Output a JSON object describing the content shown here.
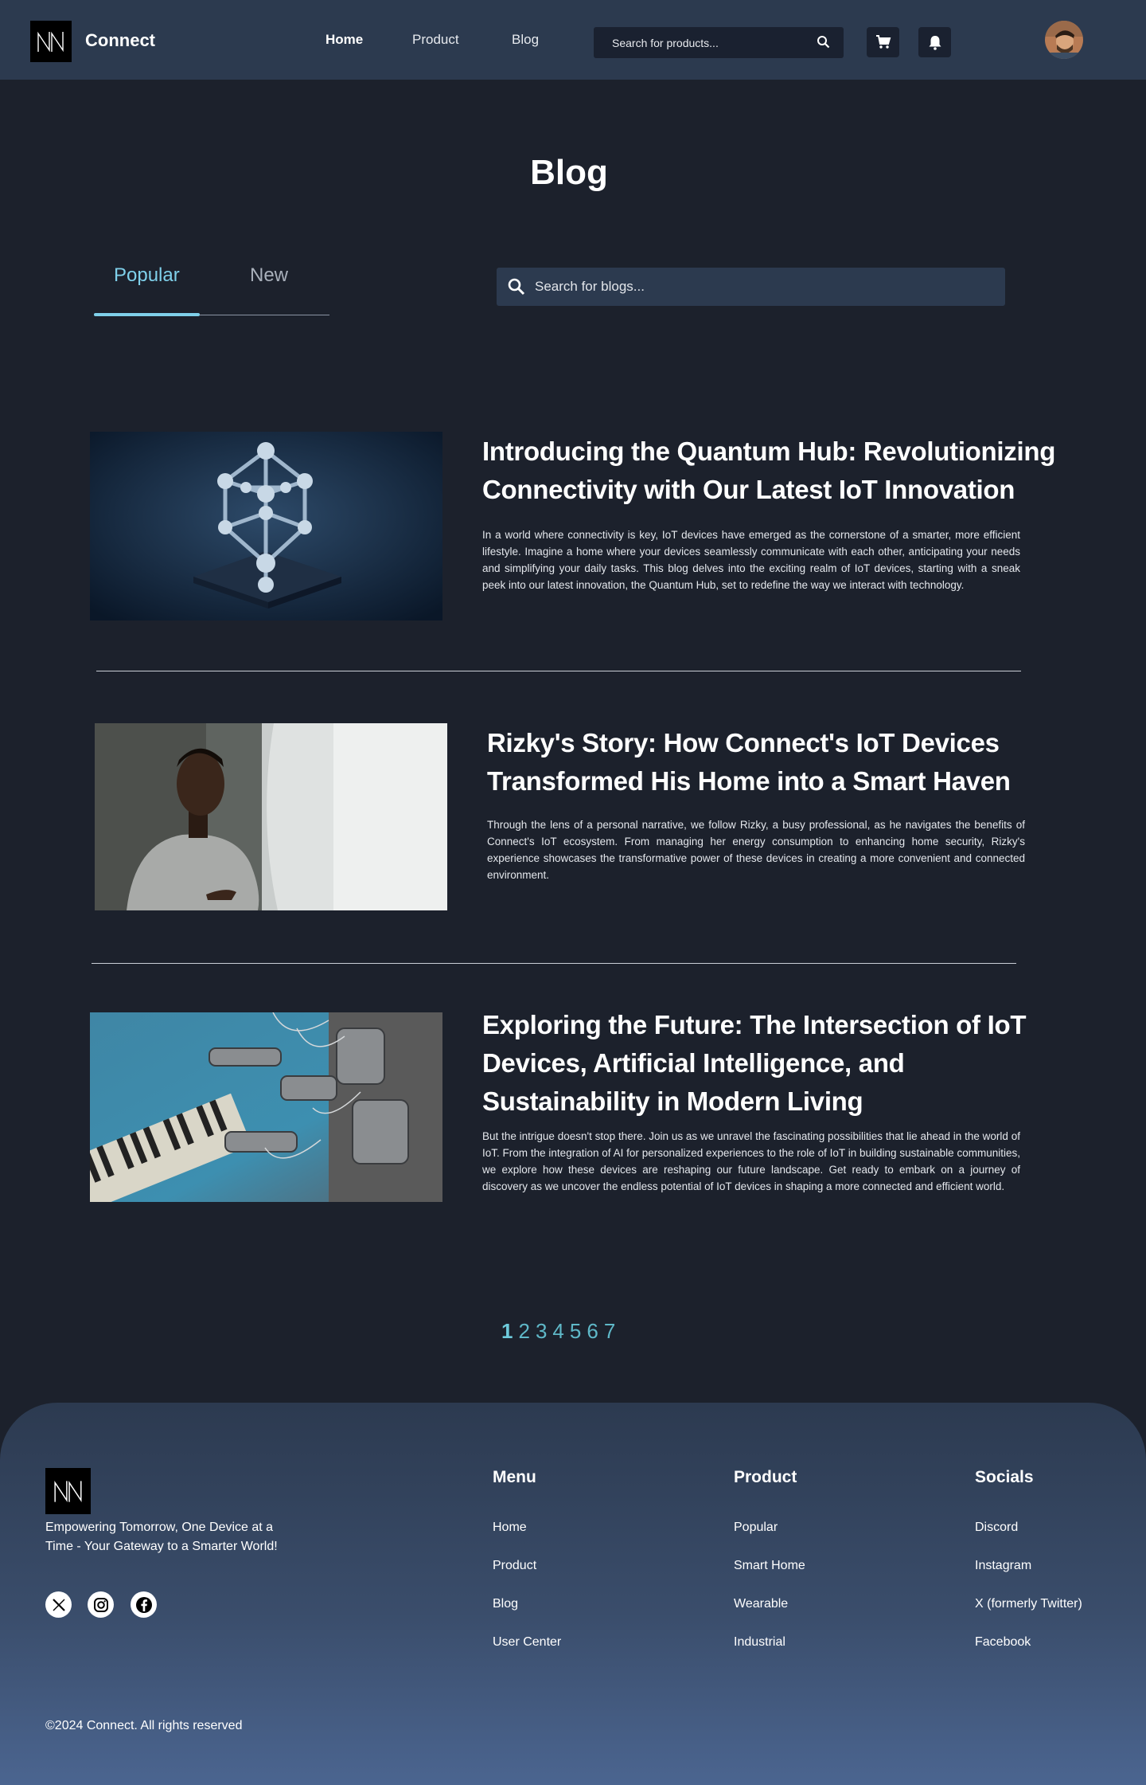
{
  "header": {
    "brand": "Connect",
    "nav": [
      "Home",
      "Product",
      "Blog"
    ],
    "search_placeholder": "Search for products...",
    "icons": [
      "search-icon",
      "cart-icon",
      "bell-icon"
    ]
  },
  "blog": {
    "title": "Blog",
    "tabs": [
      "Popular",
      "New"
    ],
    "active_tab": "Popular",
    "search_placeholder": "Search for blogs..."
  },
  "posts": [
    {
      "title": "Introducing the Quantum Hub: Revolutionizing Connectivity with Our Latest IoT Innovation",
      "excerpt": "In a world where connectivity is key, IoT devices have emerged as the  cornerstone of a smarter, more efficient lifestyle. Imagine a home where  your devices seamlessly communicate with each other, anticipating your  needs and simplifying your daily tasks. This blog delves into the  exciting realm of IoT devices, starting with a sneak peek into our latest innovation, the Quantum Hub, set to redefine the way we interact with technology."
    },
    {
      "title": "Rizky's Story: How Connect's IoT Devices Transformed His Home into a Smart Haven",
      "excerpt": "Through the lens of a personal narrative, we follow Rizky, a busy professional, as he navigates the benefits of Connect's IoT ecosystem. From managing her energy  consumption to enhancing home security, Rizky's experience showcases the  transformative power of these devices in creating a more convenient and connected environment."
    },
    {
      "title": "Exploring the Future: The Intersection of IoT Devices, Artificial Intelligence, and Sustainability in Modern Living",
      "excerpt": "But the intrigue doesn't stop  there. Join us as we unravel the fascinating possibilities that lie  ahead in the world of IoT. From the integration of AI for personalized  experiences to the role of IoT in building sustainable communities, we  explore how these devices are reshaping our future landscape. Get ready  to embark on a journey of discovery as we uncover the endless potential  of IoT devices in shaping a more connected and efficient world."
    }
  ],
  "pagination": {
    "pages": [
      "1",
      "2",
      "3",
      "4",
      "5",
      "6",
      "7"
    ],
    "current": "1"
  },
  "footer": {
    "tagline": "Empowering Tomorrow, One Device at a Time - Your Gateway to a Smarter World!",
    "social_icons": [
      "x-icon",
      "instagram-icon",
      "facebook-icon"
    ],
    "columns": [
      {
        "title": "Menu",
        "links": [
          "Home",
          "Product",
          "Blog",
          "User Center"
        ]
      },
      {
        "title": "Product",
        "links": [
          "Popular",
          "Smart Home",
          "Wearable",
          "Industrial"
        ]
      },
      {
        "title": "Socials",
        "links": [
          "Discord",
          "Instagram",
          "X (formerly Twitter)",
          "Facebook"
        ]
      }
    ],
    "copyright": "©2024 Connect. All rights reserved"
  },
  "colors": {
    "background": "#1c212c",
    "header": "#2c3a4f",
    "accent": "#7fd0ea",
    "pagination": "#5fb8c8"
  }
}
